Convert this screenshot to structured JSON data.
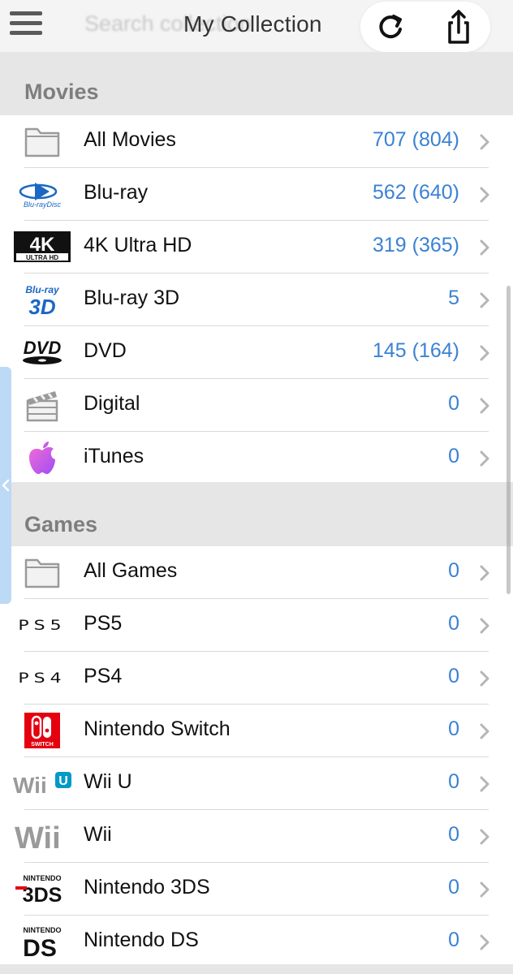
{
  "header": {
    "title": "My Collection",
    "search_placeholder": "Search collection"
  },
  "colors": {
    "accent": "#3b82d4",
    "section_bg": "#e6e6e6",
    "section_text": "#7e7e7e",
    "nintendo_red": "#e4000f",
    "wiiu_blue": "#009ac7",
    "itunes_gradient": [
      "#f06bd6",
      "#a14df5"
    ]
  },
  "sections": [
    {
      "label": "Movies",
      "rows": [
        {
          "name": "All Movies",
          "count": "707 (804)",
          "icon": "folder-icon"
        },
        {
          "name": "Blu-ray",
          "count": "562 (640)",
          "icon": "bluray-logo-icon"
        },
        {
          "name": "4K Ultra HD",
          "count": "319 (365)",
          "icon": "4k-ultra-hd-logo-icon"
        },
        {
          "name": "Blu-ray 3D",
          "count": "5",
          "icon": "bluray-3d-logo-icon"
        },
        {
          "name": "DVD",
          "count": "145 (164)",
          "icon": "dvd-logo-icon"
        },
        {
          "name": "Digital",
          "count": "0",
          "icon": "clapperboard-icon"
        },
        {
          "name": "iTunes",
          "count": "0",
          "icon": "apple-icon"
        }
      ]
    },
    {
      "label": "Games",
      "rows": [
        {
          "name": "All Games",
          "count": "0",
          "icon": "folder-icon"
        },
        {
          "name": "PS5",
          "count": "0",
          "icon": "ps5-logo-icon"
        },
        {
          "name": "PS4",
          "count": "0",
          "icon": "ps4-logo-icon"
        },
        {
          "name": "Nintendo Switch",
          "count": "0",
          "icon": "nintendo-switch-logo-icon"
        },
        {
          "name": "Wii U",
          "count": "0",
          "icon": "wii-u-logo-icon"
        },
        {
          "name": "Wii",
          "count": "0",
          "icon": "wii-logo-icon"
        },
        {
          "name": "Nintendo 3DS",
          "count": "0",
          "icon": "nintendo-3ds-logo-icon"
        },
        {
          "name": "Nintendo DS",
          "count": "0",
          "icon": "nintendo-ds-logo-icon"
        }
      ]
    }
  ],
  "logos": {
    "bluray_sub": "Blu-rayDisc",
    "uhd_big": "4K",
    "uhd_small": "ULTRA HD",
    "bluray3d_top": "Blu-ray",
    "bluray3d_big": "3D",
    "dvd": "DVD",
    "ps5": "PS5",
    "ps4": "PS4",
    "switch_word": "SWITCH",
    "wii": "Wii",
    "wiiu_u": "U",
    "nintendo_small": "NINTENDO",
    "three_ds": "3DS",
    "ds": "DS"
  }
}
